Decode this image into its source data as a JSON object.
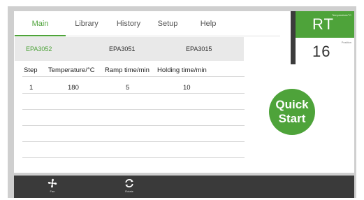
{
  "tabs": [
    {
      "label": "Main"
    },
    {
      "label": "Library"
    },
    {
      "label": "History"
    },
    {
      "label": "Setup"
    },
    {
      "label": "Help"
    }
  ],
  "methods": [
    {
      "label": "EPA3052"
    },
    {
      "label": "EPA3051"
    },
    {
      "label": "EPA3015"
    }
  ],
  "table": {
    "headers": [
      "Step",
      "Temperature/°C",
      "Ramp time/min",
      "Holding time/min"
    ],
    "rows": [
      [
        "1",
        "180",
        "5",
        "10"
      ]
    ]
  },
  "status": {
    "temperature_caption": "Temperature/°C",
    "temperature_value": "RT",
    "position_caption": "Position",
    "position_value": "16"
  },
  "quick_start": {
    "line1": "Quick",
    "line2": "Start"
  },
  "toolbar": {
    "fan_label": "Fan",
    "rotate_label": "Rotate"
  },
  "colors": {
    "accent": "#4ea33a",
    "bar": "#3a3a3a"
  }
}
